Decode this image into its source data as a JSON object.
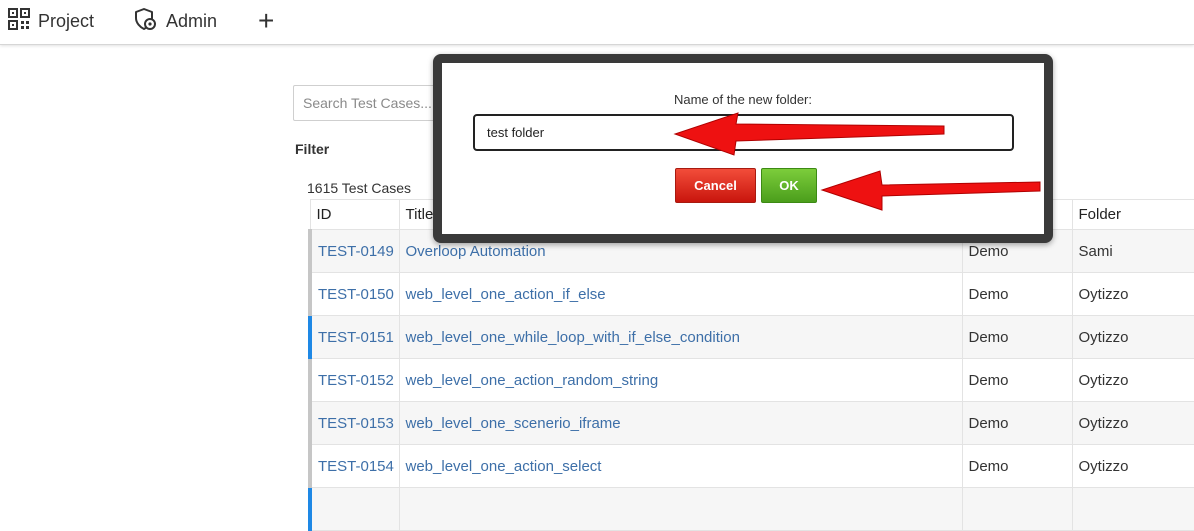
{
  "nav": {
    "project_label": "Project",
    "admin_label": "Admin",
    "add_label": "+"
  },
  "search": {
    "placeholder": "Search Test Cases...."
  },
  "filter": {
    "label": "Filter"
  },
  "table": {
    "count_label": "1615 Test Cases",
    "columns": [
      "ID",
      "Title",
      "",
      "Folder"
    ],
    "rows": [
      {
        "id": "TEST-0149",
        "title": "Overloop Automation",
        "project": "Demo",
        "folder": "Sami"
      },
      {
        "id": "TEST-0150",
        "title": "web_level_one_action_if_else",
        "project": "Demo",
        "folder": "Oytizzo"
      },
      {
        "id": "TEST-0151",
        "title": "web_level_one_while_loop_with_if_else_condition",
        "project": "Demo",
        "folder": "Oytizzo"
      },
      {
        "id": "TEST-0152",
        "title": "web_level_one_action_random_string",
        "project": "Demo",
        "folder": "Oytizzo"
      },
      {
        "id": "TEST-0153",
        "title": "web_level_one_scenerio_iframe",
        "project": "Demo",
        "folder": "Oytizzo"
      },
      {
        "id": "TEST-0154",
        "title": "web_level_one_action_select",
        "project": "Demo",
        "folder": "Oytizzo"
      }
    ]
  },
  "modal": {
    "label": "Name of the new folder:",
    "input_value": "test folder",
    "cancel_label": "Cancel",
    "ok_label": "OK"
  },
  "colors": {
    "link": "#3d6fa8",
    "selected_row_accent": "#1e88e5",
    "cancel": "#d9261a",
    "ok": "#5cb52b",
    "annotation_arrow": "#ee1111"
  },
  "icons": {
    "project": "qr-grid-icon",
    "admin": "shield-gear-icon",
    "add": "plus-icon"
  }
}
